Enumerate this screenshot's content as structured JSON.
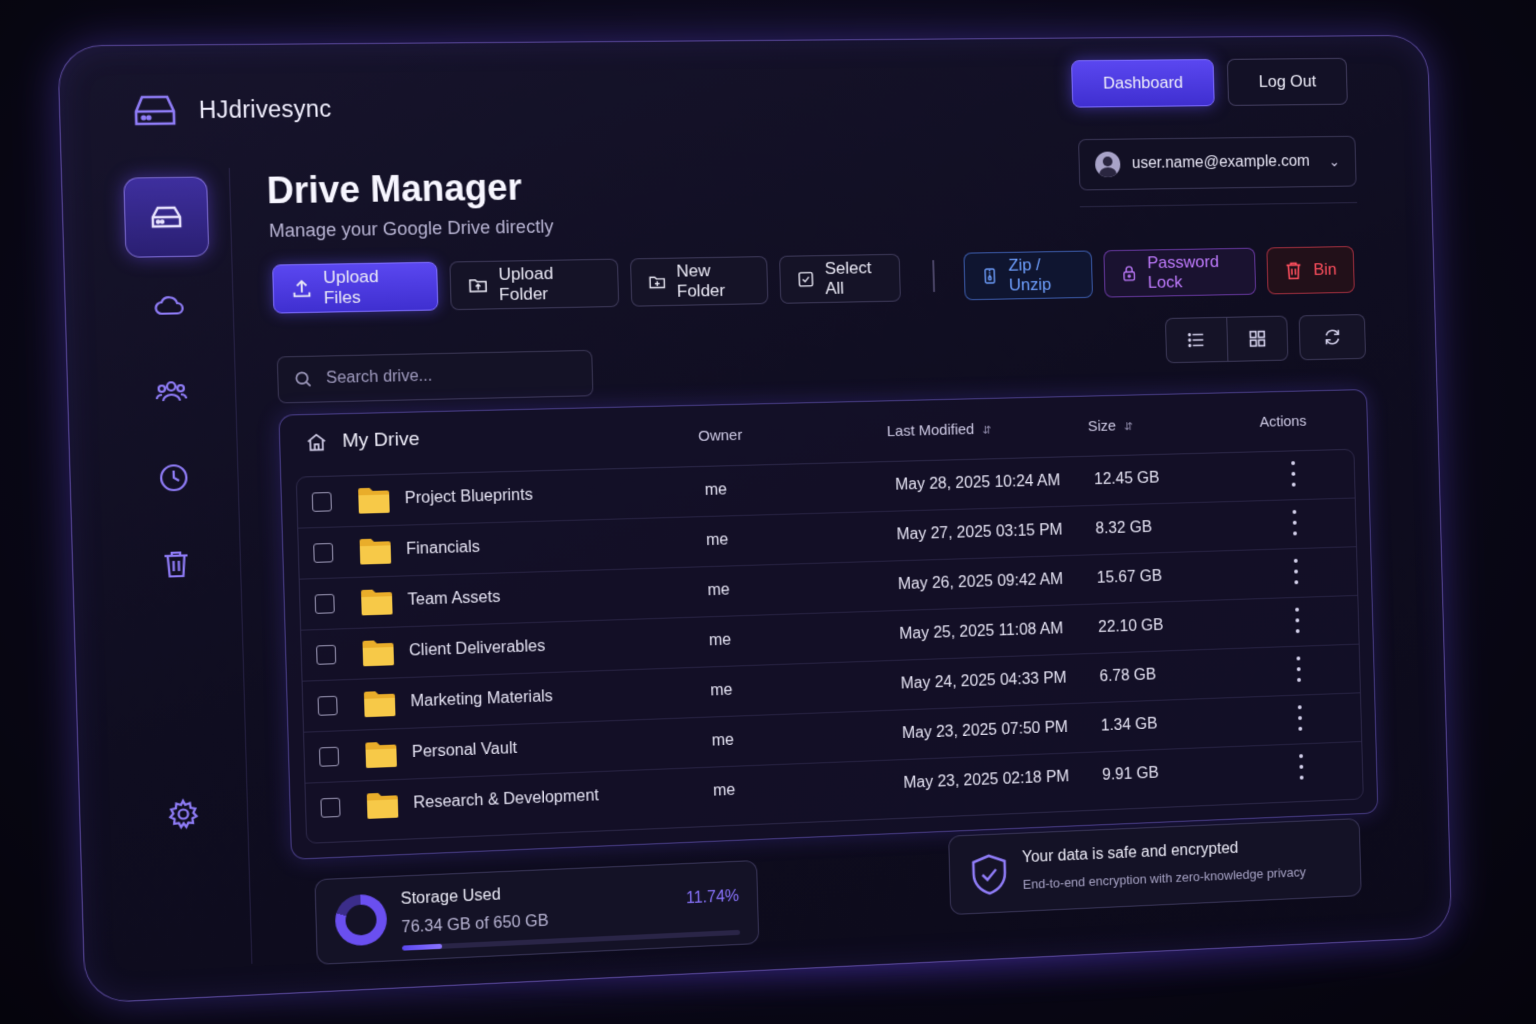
{
  "app": {
    "name": "HJdrivesync"
  },
  "header": {
    "dashboard_label": "Dashboard",
    "logout_label": "Log Out",
    "user_email": "user.name@example.com"
  },
  "page": {
    "title": "Drive Manager",
    "subtitle": "Manage your Google Drive directly"
  },
  "sidebar": {
    "items": [
      {
        "icon": "drive-icon",
        "active": true
      },
      {
        "icon": "cloud-icon",
        "active": false
      },
      {
        "icon": "users-icon",
        "active": false
      },
      {
        "icon": "clock-icon",
        "active": false
      },
      {
        "icon": "trash-icon",
        "active": false
      },
      {
        "icon": "gear-icon",
        "active": false
      }
    ]
  },
  "toolbar": {
    "upload_files": "Upload Files",
    "upload_folder": "Upload Folder",
    "new_folder": "New Folder",
    "select_all": "Select All",
    "zip_unzip": "Zip / Unzip",
    "password_lock": "Password Lock",
    "bin": "Bin"
  },
  "search": {
    "placeholder": "Search drive..."
  },
  "table": {
    "root_label": "My Drive",
    "headers": {
      "owner": "Owner",
      "modified": "Last Modified",
      "size": "Size",
      "actions": "Actions"
    },
    "rows": [
      {
        "name": "Project Blueprints",
        "owner": "me",
        "modified": "May 28, 2025 10:24 AM",
        "size": "12.45 GB"
      },
      {
        "name": "Financials",
        "owner": "me",
        "modified": "May 27, 2025 03:15 PM",
        "size": "8.32 GB"
      },
      {
        "name": "Team Assets",
        "owner": "me",
        "modified": "May 26, 2025 09:42 AM",
        "size": "15.67 GB"
      },
      {
        "name": "Client Deliverables",
        "owner": "me",
        "modified": "May 25, 2025 11:08 AM",
        "size": "22.10 GB"
      },
      {
        "name": "Marketing Materials",
        "owner": "me",
        "modified": "May 24, 2025 04:33 PM",
        "size": "6.78 GB"
      },
      {
        "name": "Personal Vault",
        "owner": "me",
        "modified": "May 23, 2025 07:50 PM",
        "size": "1.34 GB"
      },
      {
        "name": "Research & Development",
        "owner": "me",
        "modified": "May 23, 2025 02:18 PM",
        "size": "9.91 GB"
      }
    ]
  },
  "storage": {
    "label": "Storage Used",
    "value": "76.34 GB of 650 GB",
    "percent_text": "11.74%",
    "fraction": 0.1174
  },
  "security": {
    "title": "Your data is safe and encrypted",
    "subtitle": "End-to-end encryption with zero-knowledge privacy"
  },
  "colors": {
    "accent": "#5a47f0",
    "zip": "#6fa0ff",
    "lock": "#c07bff",
    "bin": "#ff4f5e",
    "folder": "#f5c542"
  }
}
